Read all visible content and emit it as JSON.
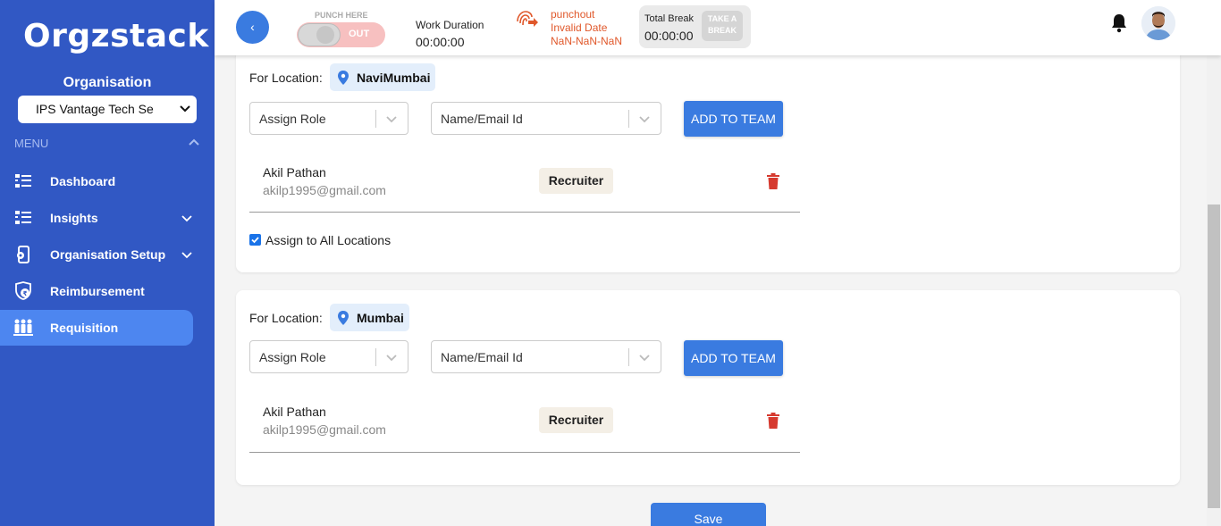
{
  "sidebar": {
    "logo": "Orgzstack",
    "org_label": "Organisation",
    "org_selected": "IPS Vantage Tech Se",
    "menu_label": "MENU",
    "items": [
      {
        "label": "Dashboard",
        "icon": "list-icon"
      },
      {
        "label": "Insights",
        "icon": "list-icon"
      },
      {
        "label": "Organisation Setup",
        "icon": "phone-settings-icon"
      },
      {
        "label": "Reimbursement",
        "icon": "shield-money-icon"
      },
      {
        "label": "Requisition",
        "icon": "people-icon"
      }
    ]
  },
  "topbar": {
    "back_glyph": "‹",
    "punch_label": "PUNCH HERE",
    "punch_state": "OUT",
    "work_duration_label": "Work Duration",
    "work_duration_value": "00:00:00",
    "punchout_text": "punchout Invalid Date NaN-NaN-NaN",
    "total_break_label": "Total Break",
    "total_break_value": "00:00:00",
    "take_break_label": "TAKE A BREAK"
  },
  "locations": [
    {
      "for_location_label": "For Location:",
      "location": "NaviMumbai",
      "role_placeholder": "Assign Role",
      "name_placeholder": "Name/Email Id",
      "add_button": "ADD TO TEAM",
      "member": {
        "name": "Akil Pathan",
        "email": "akilp1995@gmail.com",
        "role": "Recruiter"
      },
      "assign_all_label": "Assign to All Locations",
      "assign_all_checked": true
    },
    {
      "for_location_label": "For Location:",
      "location": "Mumbai",
      "role_placeholder": "Assign Role",
      "name_placeholder": "Name/Email Id",
      "add_button": "ADD TO TEAM",
      "member": {
        "name": "Akil Pathan",
        "email": "akilp1995@gmail.com",
        "role": "Recruiter"
      }
    }
  ],
  "save_label": "Save",
  "colors": {
    "sidebar": "#3158c4",
    "active_nav": "#4d86f0",
    "primary_button": "#3a7be0",
    "punchout_text": "#e0582b",
    "delete_icon": "#d63a2f"
  }
}
